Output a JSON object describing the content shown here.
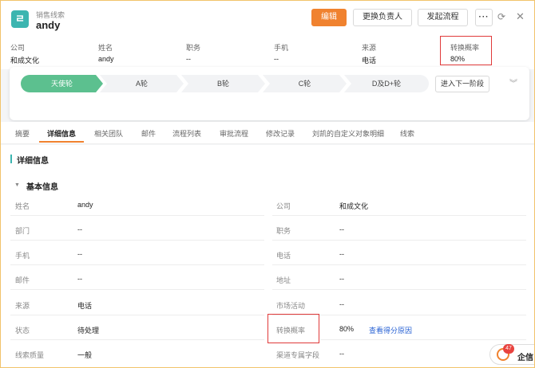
{
  "header": {
    "object_type": "销售线索",
    "name": "andy",
    "logo_glyph": "ㄹ",
    "buttons": {
      "edit": "编辑",
      "change_owner": "更换负责人",
      "start_flow": "发起流程",
      "more": "···"
    },
    "fields": [
      {
        "label": "公司",
        "value": "和成文化"
      },
      {
        "label": "姓名",
        "value": "andy"
      },
      {
        "label": "职务",
        "value": "--"
      },
      {
        "label": "手机",
        "value": "--"
      },
      {
        "label": "来源",
        "value": "电话"
      },
      {
        "label": "转换概率",
        "value": "80%"
      }
    ]
  },
  "stages": {
    "items": [
      "天使轮",
      "A轮",
      "B轮",
      "C轮",
      "D及D+轮"
    ],
    "active_index": 0,
    "next_button": "进入下一阶段"
  },
  "tabs": [
    "摘要",
    "详细信息",
    "相关团队",
    "邮件",
    "流程列表",
    "审批流程",
    "修改记录",
    "刘凯的自定义对象明细",
    "线索"
  ],
  "active_tab": 1,
  "detail": {
    "section_title": "详细信息",
    "group_title": "基本信息",
    "rows": [
      {
        "l_label": "姓名",
        "l_value": "andy",
        "r_label": "公司",
        "r_value": "和成文化"
      },
      {
        "l_label": "部门",
        "l_value": "--",
        "r_label": "职务",
        "r_value": "--"
      },
      {
        "l_label": "手机",
        "l_value": "--",
        "r_label": "电话",
        "r_value": "--"
      },
      {
        "l_label": "邮件",
        "l_value": "--",
        "r_label": "地址",
        "r_value": "--"
      },
      {
        "l_label": "来源",
        "l_value": "电话",
        "r_label": "市场活动",
        "r_value": "--"
      },
      {
        "l_label": "状态",
        "l_value": "待处理",
        "r_label": "转换概率",
        "r_value": "80%",
        "r_link": "查看得分原因"
      },
      {
        "l_label": "线索质量",
        "l_value": "一般",
        "r_label": "渠道专属字段",
        "r_value": "--"
      }
    ]
  },
  "notify": {
    "count": "47",
    "label": "企信"
  },
  "colors": {
    "accent": "#f0822f",
    "brand": "#3cb5b0",
    "stage_active": "#5cc08f",
    "highlight": "#e03a3a",
    "link": "#2a63d4"
  }
}
